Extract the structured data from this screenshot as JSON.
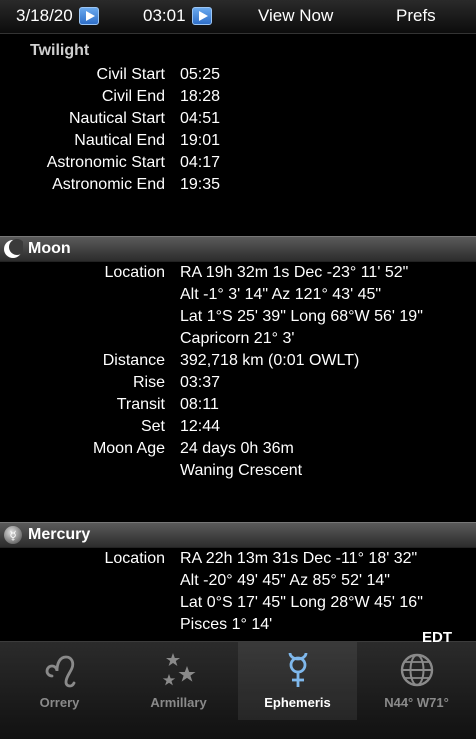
{
  "topbar": {
    "date": "3/18/20",
    "time": "03:01",
    "view_now": "View Now",
    "prefs": "Prefs"
  },
  "twilight": {
    "heading": "Twilight",
    "rows": [
      {
        "label": "Civil Start",
        "value": "05:25"
      },
      {
        "label": "Civil End",
        "value": "18:28"
      },
      {
        "label": "Nautical Start",
        "value": "04:51"
      },
      {
        "label": "Nautical End",
        "value": "19:01"
      },
      {
        "label": "Astronomic Start",
        "value": "04:17"
      },
      {
        "label": "Astronomic End",
        "value": "19:35"
      }
    ]
  },
  "moon": {
    "title": "Moon",
    "location_label": "Location",
    "location_lines": [
      "RA 19h 32m 1s Dec -23° 11' 52\"",
      "Alt -1° 3' 14\" Az 121° 43' 45\"",
      "Lat 1°S 25' 39\" Long 68°W 56' 19\"",
      "Capricorn 21° 3'"
    ],
    "distance_label": "Distance",
    "distance": "392,718 km (0:01 OWLT)",
    "rise_label": "Rise",
    "rise": "03:37",
    "transit_label": "Transit",
    "transit": "08:11",
    "set_label": "Set",
    "set": "12:44",
    "age_label": "Moon Age",
    "age": "24 days 0h 36m",
    "phase": "Waning Crescent"
  },
  "mercury": {
    "title": "Mercury",
    "location_label": "Location",
    "location_lines": [
      "RA 22h 13m 31s Dec -11° 18' 32\"",
      "Alt -20° 49' 45\" Az 85° 52' 14\"",
      "Lat 0°S 17' 45\" Long 28°W 45' 16\"",
      "Pisces 1° 14'"
    ]
  },
  "tabbar": {
    "timezone": "EDT",
    "tabs": [
      {
        "label": "Orrery",
        "icon": "leo-icon"
      },
      {
        "label": "Armillary",
        "icon": "stars-icon"
      },
      {
        "label": "Ephemeris",
        "icon": "mercury-symbol-icon"
      },
      {
        "label": "N44° W71°",
        "icon": "globe-icon"
      }
    ]
  },
  "colors": {
    "background": "#000000",
    "active_tab_text": "#ffffff",
    "inactive_tab_text": "#8a8a8a",
    "play_button": "#3d7fd6"
  }
}
